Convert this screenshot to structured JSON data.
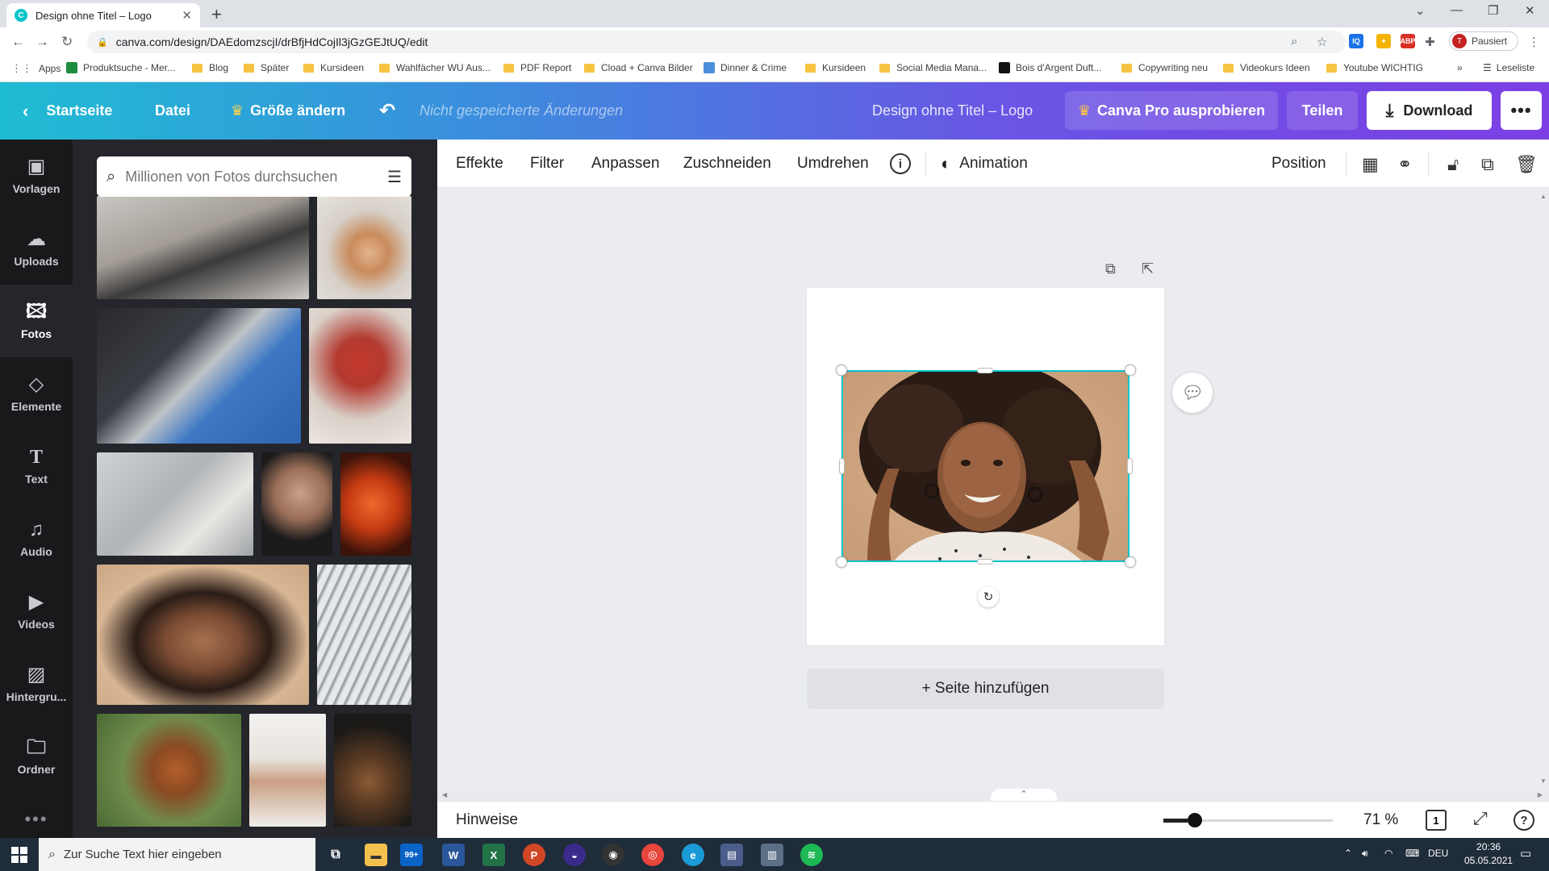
{
  "browser": {
    "tab_title": "Design ohne Titel – Logo",
    "url": "canva.com/design/DAEdomzscjI/drBfjHdCojIl3jGzGEJtUQ/edit",
    "profile_initial": "T",
    "profile_label": "Pausiert",
    "ext_badge_iq": "IQ",
    "ext_badge_abp": "ABP",
    "bookmarks": [
      {
        "label": "Apps"
      },
      {
        "label": "Produktsuche - Mer..."
      },
      {
        "label": "Blog"
      },
      {
        "label": "Später"
      },
      {
        "label": "Kursideen"
      },
      {
        "label": "Wahlfächer WU Aus..."
      },
      {
        "label": "PDF Report"
      },
      {
        "label": "Cload + Canva Bilder"
      },
      {
        "label": "Dinner & Crime"
      },
      {
        "label": "Kursideen"
      },
      {
        "label": "Social Media Mana..."
      },
      {
        "label": "Bois d'Argent Duft..."
      },
      {
        "label": "Copywriting neu"
      },
      {
        "label": "Videokurs Ideen"
      },
      {
        "label": "Youtube WICHTIG"
      }
    ],
    "more_bookmarks": "»",
    "reading_list": "Leseliste"
  },
  "header": {
    "home": "Startseite",
    "file": "Datei",
    "resize": "Größe ändern",
    "unsaved": "Nicht gespeicherte Änderungen",
    "design_title": "Design ohne Titel – Logo",
    "pro": "Canva Pro ausprobieren",
    "share": "Teilen",
    "download": "Download"
  },
  "sidebar": {
    "items": [
      {
        "label": "Vorlagen"
      },
      {
        "label": "Uploads"
      },
      {
        "label": "Fotos"
      },
      {
        "label": "Elemente"
      },
      {
        "label": "Text"
      },
      {
        "label": "Audio"
      },
      {
        "label": "Videos"
      },
      {
        "label": "Hintergru..."
      },
      {
        "label": "Ordner"
      }
    ]
  },
  "panel": {
    "search_placeholder": "Millionen von Fotos durchsuchen"
  },
  "toolbar": {
    "effects": "Effekte",
    "filter": "Filter",
    "adjust": "Anpassen",
    "crop": "Zuschneiden",
    "flip": "Umdrehen",
    "animation": "Animation",
    "position": "Position"
  },
  "canvas": {
    "add_page": "+ Seite hinzufügen"
  },
  "footer": {
    "hints": "Hinweise",
    "zoom": "71 %",
    "zoom_level": 0.71,
    "pages": "1"
  },
  "taskbar": {
    "search_placeholder": "Zur Suche Text hier eingeben",
    "mail_badge": "99+",
    "language": "DEU",
    "time": "20:36",
    "date": "05.05.2021"
  },
  "colors": {
    "selection": "#00c4cc",
    "sidebar": "#18191b",
    "panel": "#25262b"
  }
}
